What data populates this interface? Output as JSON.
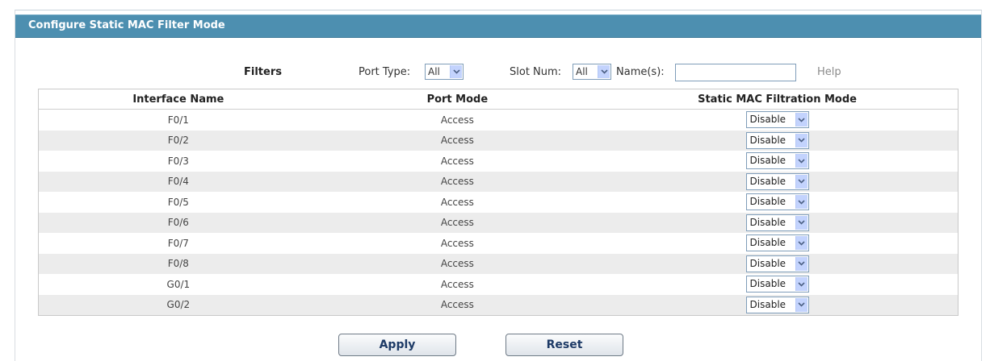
{
  "panel": {
    "title": "Configure Static MAC Filter Mode"
  },
  "filters": {
    "label": "Filters",
    "port_type_label": "Port Type:",
    "port_type_value": "All",
    "slot_num_label": "Slot Num:",
    "slot_num_value": "All",
    "names_label": "Name(s):",
    "names_value": "",
    "help_label": "Help"
  },
  "table": {
    "headers": [
      "Interface Name",
      "Port Mode",
      "Static MAC Filtration Mode"
    ],
    "rows": [
      {
        "interface": "F0/1",
        "port_mode": "Access",
        "filter_mode": "Disable"
      },
      {
        "interface": "F0/2",
        "port_mode": "Access",
        "filter_mode": "Disable"
      },
      {
        "interface": "F0/3",
        "port_mode": "Access",
        "filter_mode": "Disable"
      },
      {
        "interface": "F0/4",
        "port_mode": "Access",
        "filter_mode": "Disable"
      },
      {
        "interface": "F0/5",
        "port_mode": "Access",
        "filter_mode": "Disable"
      },
      {
        "interface": "F0/6",
        "port_mode": "Access",
        "filter_mode": "Disable"
      },
      {
        "interface": "F0/7",
        "port_mode": "Access",
        "filter_mode": "Disable"
      },
      {
        "interface": "F0/8",
        "port_mode": "Access",
        "filter_mode": "Disable"
      },
      {
        "interface": "G0/1",
        "port_mode": "Access",
        "filter_mode": "Disable"
      },
      {
        "interface": "G0/2",
        "port_mode": "Access",
        "filter_mode": "Disable"
      }
    ]
  },
  "buttons": {
    "apply_label": "Apply",
    "reset_label": "Reset"
  },
  "icons": {
    "dropdown": "chevron-down-icon"
  },
  "colors": {
    "header_bar": "#4d8fb0",
    "row_alt": "#ececec",
    "dropdown_arrow_bg": "#c3d3fd",
    "button_text": "#1d3a66"
  }
}
